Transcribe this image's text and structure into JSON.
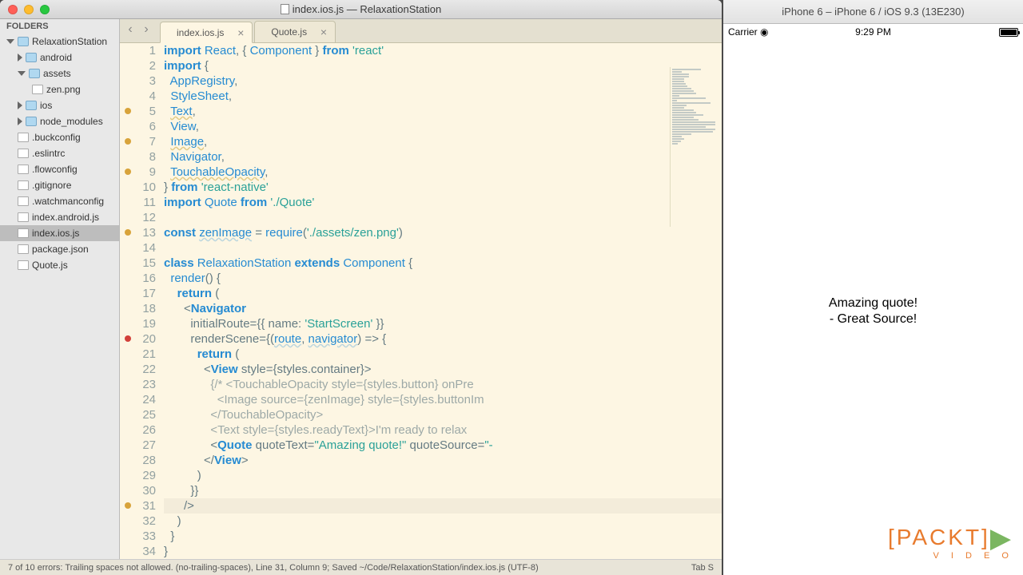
{
  "window": {
    "title": "index.ios.js — RelaxationStation"
  },
  "sidebar": {
    "header": "FOLDERS",
    "tree": [
      {
        "label": "RelaxationStation",
        "type": "folder",
        "indent": 0,
        "open": true
      },
      {
        "label": "android",
        "type": "folder",
        "indent": 1,
        "open": false
      },
      {
        "label": "assets",
        "type": "folder",
        "indent": 1,
        "open": true
      },
      {
        "label": "zen.png",
        "type": "file",
        "indent": 2
      },
      {
        "label": "ios",
        "type": "folder",
        "indent": 1,
        "open": false
      },
      {
        "label": "node_modules",
        "type": "folder",
        "indent": 1,
        "open": false
      },
      {
        "label": ".buckconfig",
        "type": "file",
        "indent": 1
      },
      {
        "label": ".eslintrc",
        "type": "file",
        "indent": 1
      },
      {
        "label": ".flowconfig",
        "type": "file",
        "indent": 1
      },
      {
        "label": ".gitignore",
        "type": "file",
        "indent": 1
      },
      {
        "label": ".watchmanconfig",
        "type": "file",
        "indent": 1
      },
      {
        "label": "index.android.js",
        "type": "file",
        "indent": 1
      },
      {
        "label": "index.ios.js",
        "type": "file",
        "indent": 1,
        "selected": true
      },
      {
        "label": "package.json",
        "type": "file",
        "indent": 1
      },
      {
        "label": "Quote.js",
        "type": "file",
        "indent": 1
      }
    ]
  },
  "tabs": [
    {
      "label": "index.ios.js",
      "active": true
    },
    {
      "label": "Quote.js",
      "active": false
    }
  ],
  "code_lines": [
    {
      "n": 1,
      "dot": false,
      "html": "<span class='kw'>import</span> <span class='cls'>React</span><span class='op'>,</span> <span class='op'>{</span> <span class='cls'>Component</span> <span class='op'>}</span> <span class='kw'>from</span> <span class='str'>'react'</span>"
    },
    {
      "n": 2,
      "dot": false,
      "html": "<span class='kw'>import</span> <span class='op'>{</span>"
    },
    {
      "n": 3,
      "dot": false,
      "html": "  <span class='cls'>AppRegistry</span><span class='op'>,</span>"
    },
    {
      "n": 4,
      "dot": false,
      "html": "  <span class='cls'>StyleSheet</span><span class='op'>,</span>"
    },
    {
      "n": 5,
      "dot": true,
      "html": "  <span class='cls warn'>Text</span><span class='op'>,</span>"
    },
    {
      "n": 6,
      "dot": false,
      "html": "  <span class='cls'>View</span><span class='op'>,</span>"
    },
    {
      "n": 7,
      "dot": true,
      "html": "  <span class='cls warn'>Image</span><span class='op'>,</span>"
    },
    {
      "n": 8,
      "dot": false,
      "html": "  <span class='cls'>Navigator</span><span class='op'>,</span>"
    },
    {
      "n": 9,
      "dot": true,
      "html": "  <span class='cls warn'>TouchableOpacity</span><span class='op'>,</span>"
    },
    {
      "n": 10,
      "dot": false,
      "html": "<span class='op'>}</span> <span class='kw'>from</span> <span class='str'>'react-native'</span>"
    },
    {
      "n": 11,
      "dot": false,
      "html": "<span class='kw'>import</span> <span class='cls'>Quote</span> <span class='kw'>from</span> <span class='str'>'./Quote'</span>"
    },
    {
      "n": 12,
      "dot": false,
      "html": ""
    },
    {
      "n": 13,
      "dot": true,
      "html": "<span class='kw'>const</span> <span class='id'>zenImage</span> <span class='op'>=</span> <span class='fn'>require</span><span class='op'>(</span><span class='str'>'./assets/zen.png'</span><span class='op'>)</span>"
    },
    {
      "n": 14,
      "dot": false,
      "html": ""
    },
    {
      "n": 15,
      "dot": false,
      "html": "<span class='kw'>class</span> <span class='cls'>RelaxationStation</span> <span class='kw'>extends</span> <span class='cls'>Component</span> <span class='op'>{</span>"
    },
    {
      "n": 16,
      "dot": false,
      "html": "  <span class='fn'>render</span><span class='op'>() {</span>"
    },
    {
      "n": 17,
      "dot": false,
      "html": "    <span class='kw'>return</span> <span class='op'>(</span>"
    },
    {
      "n": 18,
      "dot": false,
      "html": "      <span class='op'>&lt;</span><span class='cls'><b>Navigator</b></span>"
    },
    {
      "n": 19,
      "dot": false,
      "html": "        <span class='op'>initialRoute={{</span> name<span class='op'>:</span> <span class='str'>'StartScreen'</span> <span class='op'>}}</span>"
    },
    {
      "n": 20,
      "dot": true,
      "red": true,
      "html": "        <span class='op'>renderScene={(</span><span class='id'>route</span><span class='op'>,</span> <span class='id'>navigator</span><span class='op'>)</span> <span class='op'>=&gt; {</span>"
    },
    {
      "n": 21,
      "dot": false,
      "html": "          <span class='kw'>return</span> <span class='op'>(</span>"
    },
    {
      "n": 22,
      "dot": false,
      "html": "            <span class='op'>&lt;</span><span class='cls'><b>View</b></span> <span class='op'>style={</span>styles<span class='op'>.</span>container<span class='op'>}&gt;</span>"
    },
    {
      "n": 23,
      "dot": false,
      "html": "              <span class='cm'>{/* &lt;TouchableOpacity style={styles.button} onPre</span>"
    },
    {
      "n": 24,
      "dot": false,
      "html": "                <span class='cm'>&lt;Image source={zenImage} style={styles.buttonIm</span>"
    },
    {
      "n": 25,
      "dot": false,
      "html": "              <span class='cm'>&lt;/TouchableOpacity&gt;</span>"
    },
    {
      "n": 26,
      "dot": false,
      "html": "              <span class='cm'>&lt;Text style={styles.readyText}&gt;I'm ready to relax</span>"
    },
    {
      "n": 27,
      "dot": false,
      "html": "              <span class='op'>&lt;</span><span class='cls'><b>Quote</b></span> <span class='op'>quoteText=</span><span class='str'>\"Amazing quote!\"</span> <span class='op'>quoteSource=</span><span class='str'>\"-</span>"
    },
    {
      "n": 28,
      "dot": false,
      "html": "            <span class='op'>&lt;/</span><span class='cls'><b>View</b></span><span class='op'>&gt;</span>"
    },
    {
      "n": 29,
      "dot": false,
      "html": "          <span class='op'>)</span>"
    },
    {
      "n": 30,
      "dot": false,
      "html": "        <span class='op'>}}</span>"
    },
    {
      "n": 31,
      "dot": true,
      "cursor": true,
      "html": "      <span class='op'>/&gt;</span>"
    },
    {
      "n": 32,
      "dot": false,
      "html": "    <span class='op'>)</span>"
    },
    {
      "n": 33,
      "dot": false,
      "html": "  <span class='op'>}</span>"
    },
    {
      "n": 34,
      "dot": false,
      "html": "<span class='op'>}</span>"
    }
  ],
  "statusbar": {
    "left": "7 of 10 errors: Trailing spaces not allowed. (no-trailing-spaces), Line 31, Column 9; Saved ~/Code/RelaxationStation/index.ios.js (UTF-8)",
    "right": "Tab S"
  },
  "simulator": {
    "title": "iPhone 6 – iPhone 6 / iOS 9.3 (13E230)",
    "carrier": "Carrier",
    "time": "9:29 PM",
    "content_line1": "Amazing quote!",
    "content_line2": "- Great Source!"
  },
  "branding": {
    "name": "[PACKT]",
    "sub": "V I D E O"
  }
}
